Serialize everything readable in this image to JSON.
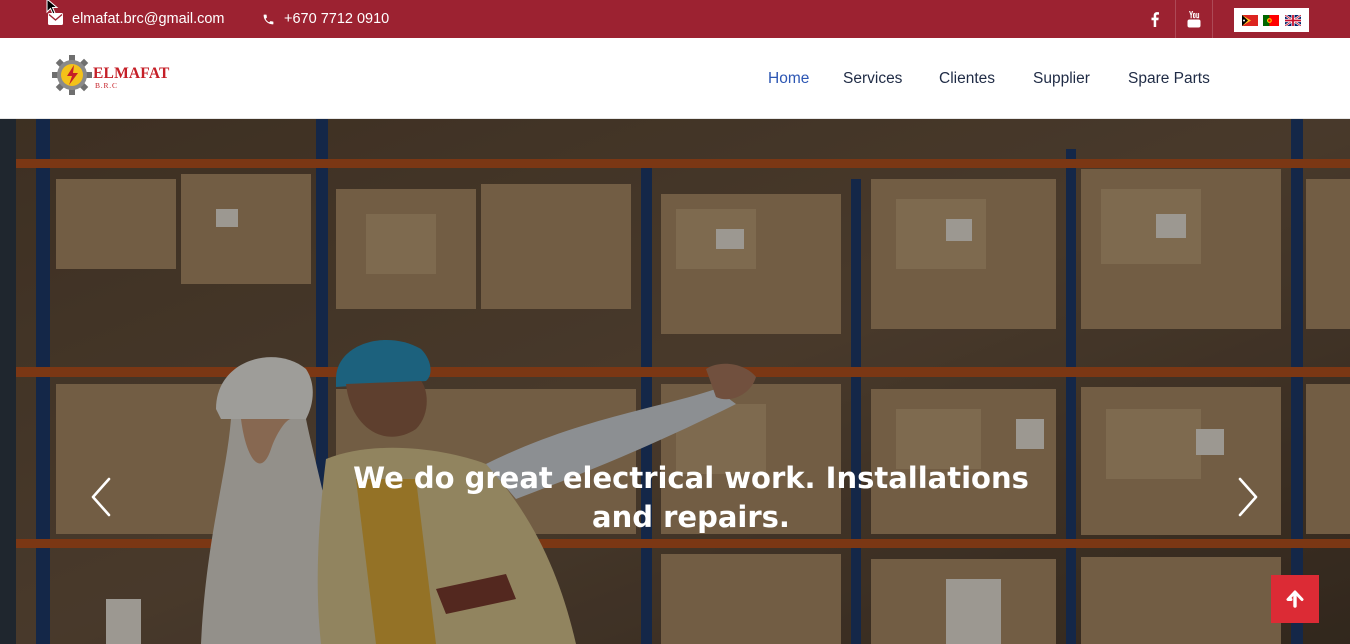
{
  "topbar": {
    "email": "elmafat.brc@gmail.com",
    "phone": "+670 7712 0910",
    "social_icons": [
      "facebook-icon",
      "youtube-icon"
    ],
    "languages": [
      "Tetum",
      "Português",
      "English"
    ]
  },
  "brand": {
    "name": "ELMAFAT",
    "sub": "B.R.C"
  },
  "nav": {
    "items": [
      {
        "label": "Home",
        "active": true
      },
      {
        "label": "Services",
        "active": false
      },
      {
        "label": "Clientes",
        "active": false
      },
      {
        "label": "Supplier",
        "active": false
      },
      {
        "label": "Spare Parts",
        "active": false
      }
    ]
  },
  "hero": {
    "caption_line1": "We do great electrical work. Installations",
    "caption_line2": "and repairs.",
    "prev_icon": "chevron-left-icon",
    "next_icon": "chevron-right-icon"
  },
  "colors": {
    "topbar": "#9c2231",
    "brand_red": "#c51f27",
    "nav_text": "#1f2b45",
    "nav_active": "#2c56b3",
    "back_to_top": "#dc2b35"
  },
  "back_to_top_icon": "arrow-up-icon"
}
